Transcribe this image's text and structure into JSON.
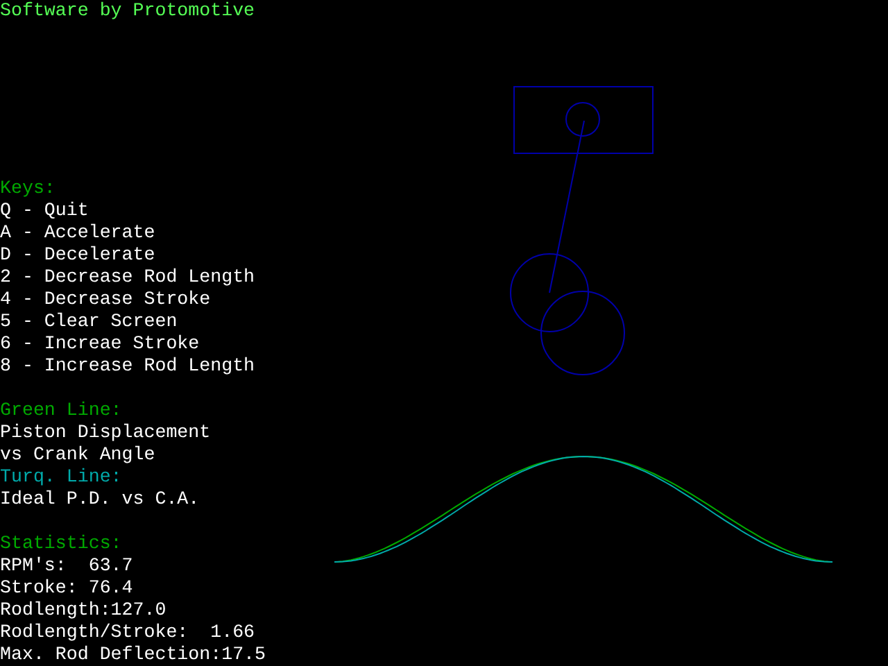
{
  "title": "Software by Protomotive",
  "keys": {
    "heading": "Keys:",
    "items": [
      "Q - Quit",
      "A - Accelerate",
      "D - Decelerate",
      "2 - Decrease Rod Length",
      "4 - Decrease Stroke",
      "5 - Clear Screen",
      "6 - Increae Stroke",
      "8 - Increase Rod Length"
    ]
  },
  "legend": [
    {
      "heading": "Green Line:",
      "color": "#00aa00",
      "lines": [
        "Piston Displacement",
        "vs Crank Angle"
      ]
    },
    {
      "heading": "Turq. Line:",
      "color": "#00aaaa",
      "lines": [
        "Ideal P.D. vs C.A."
      ]
    }
  ],
  "statistics": {
    "heading": "Statistics:",
    "items": [
      "RPM's:  63.7",
      "Stroke: 76.4",
      "Rodlength:127.0",
      "Rodlength/Stroke:  1.66",
      "Max. Rod Deflection:17.5"
    ]
  }
}
